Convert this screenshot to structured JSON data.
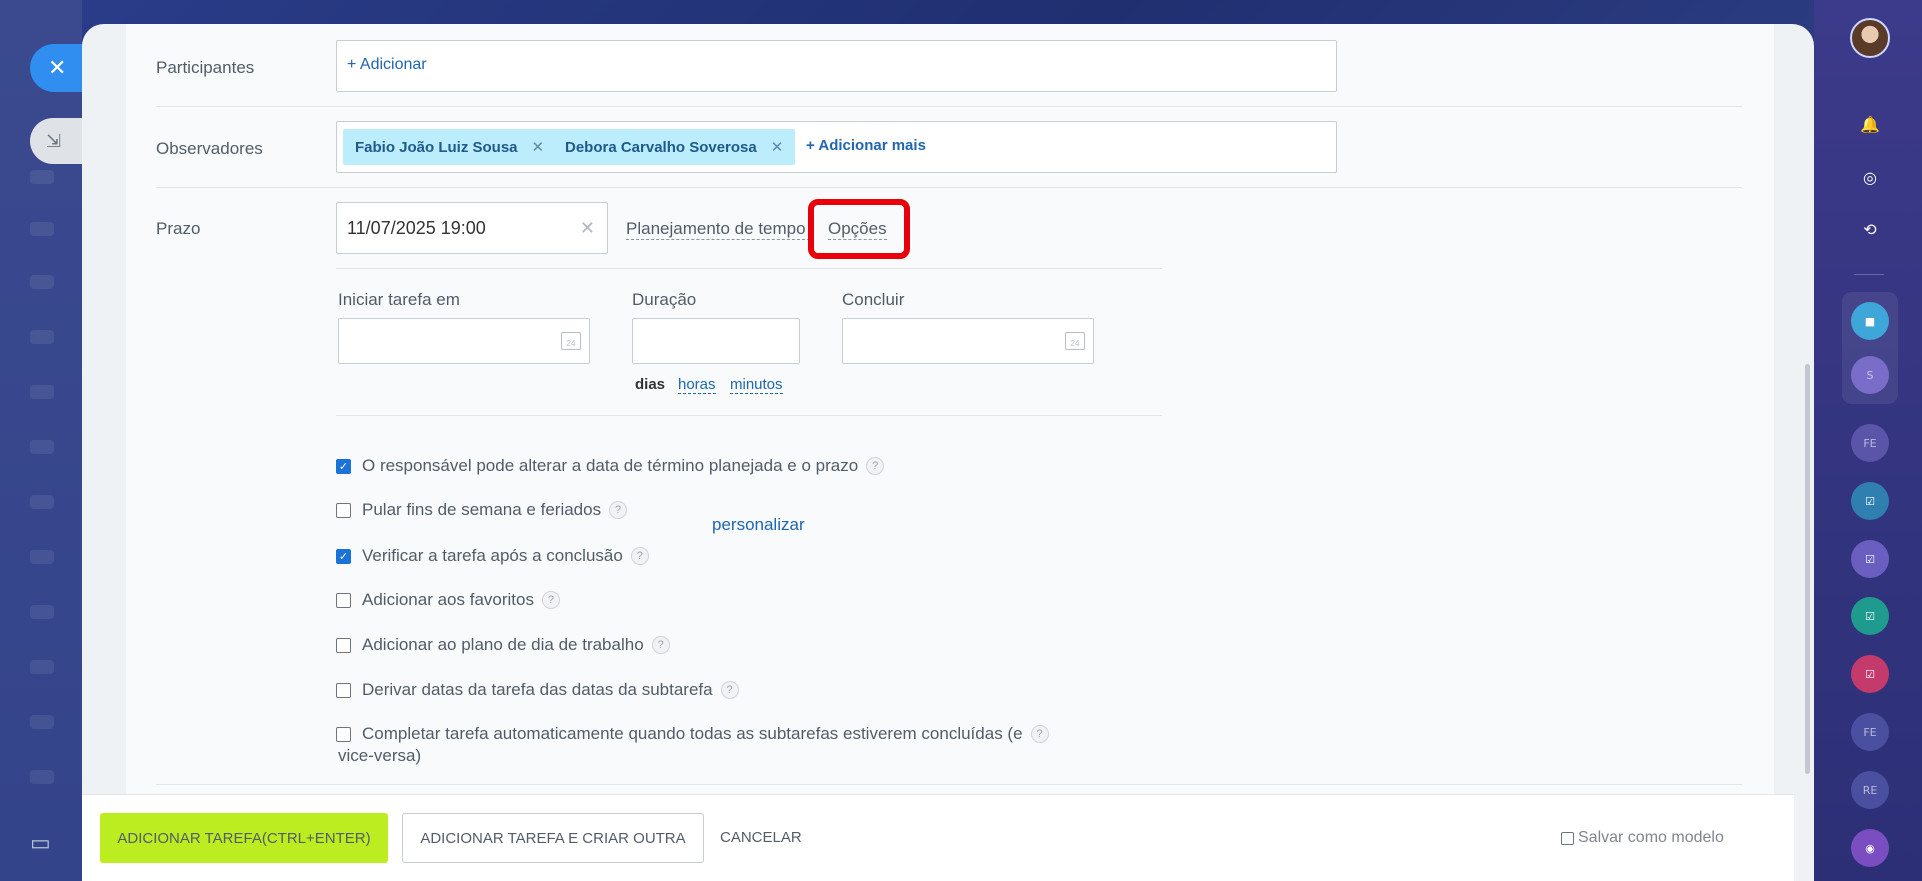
{
  "form": {
    "participants_label": "Participantes",
    "participants_add": "+ Adicionar",
    "observers_label": "Observadores",
    "observers": [
      {
        "name": "Fabio João Luiz Sousa"
      },
      {
        "name": "Debora Carvalho Soverosa"
      }
    ],
    "observers_add_more": "+ Adicionar mais",
    "deadline_label": "Prazo",
    "deadline_value": "11/07/2025 19:00",
    "time_planning_link": "Planejamento de tempo",
    "options_link": "Opções",
    "start_task_label": "Iniciar tarefa em",
    "duration_label": "Duração",
    "finish_label": "Concluir",
    "calendar_day": "24",
    "units": {
      "days": "dias",
      "hours": "horas",
      "minutes": "minutos"
    },
    "options": [
      {
        "label": "O responsável pode alterar a data de término planejada e o prazo",
        "checked": true
      },
      {
        "label": "Pular fins de semana e feriados",
        "checked": false
      },
      {
        "label": "Verificar a tarefa após a conclusão",
        "checked": true
      },
      {
        "label": "Adicionar aos favoritos",
        "checked": false
      },
      {
        "label": "Adicionar ao plano de dia de trabalho",
        "checked": false
      },
      {
        "label": "Derivar datas da tarefa das datas da subtarefa",
        "checked": false
      },
      {
        "label": "Completar tarefa automaticamente quando todas as subtarefas estiverem concluídas (e",
        "label_line2": "vice-versa)",
        "checked": false
      }
    ],
    "personalize_link": "personalizar",
    "help_glyph": "?"
  },
  "footer": {
    "add_task": "ADICIONAR TAREFA(CTRL+ENTER)",
    "add_and_create": "ADICIONAR TAREFA E CRIAR OUTRA",
    "cancel": "CANCELAR",
    "save_as_template": "Salvar como modelo"
  },
  "right_sidebar": {
    "circles": [
      "S",
      "FE",
      "FE",
      "RE"
    ]
  },
  "colors": {
    "primary_button": "#bbed21",
    "link": "#2066b0",
    "highlight": "#e8000b",
    "chip_bg": "#bcedfc",
    "checkbox_checked": "#1a73d9"
  }
}
